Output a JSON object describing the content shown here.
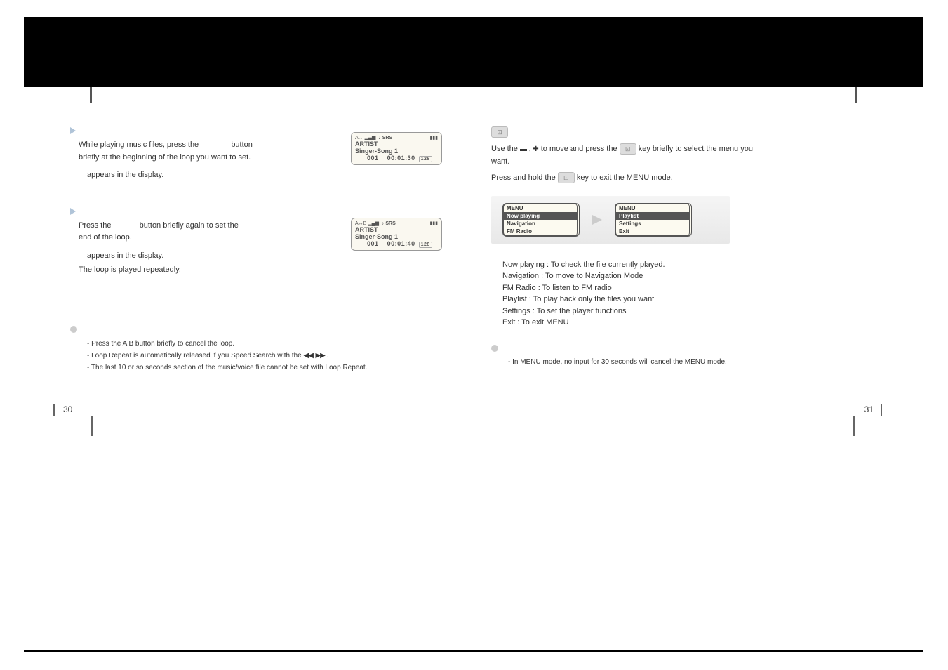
{
  "leftPage": {
    "step1": {
      "lineA": "While playing music files, press the",
      "buttonWord": "button",
      "lineB": "briefly at the beginning of the loop you want to set.",
      "result": "appears in the display."
    },
    "step2": {
      "lineA": "Press the",
      "lineB": "button briefly again to set the",
      "lineC": "end of the loop.",
      "resultA": "appears in the display.",
      "resultB": "The loop is played repeatedly."
    },
    "notes": {
      "n1": "- Press the A   B button briefly to cancel the loop.",
      "n2a": "- Loop Repeat is automatically released if you Speed Search with the  ",
      "n2icons": "◀◀, ▶▶",
      "n2b": " .",
      "n3": "- The last 10 or so seconds section of the music/voice file cannot be set with Loop Repeat."
    },
    "lcd1": {
      "topLeft": "A↔",
      "srs": "SRS",
      "artist": "ARTIST",
      "song": "Singer-Song 1",
      "track": "001",
      "time": "00:01:30",
      "badge": "128"
    },
    "lcd2": {
      "topLeft": "A↔B",
      "srs": "SRS",
      "artist": "ARTIST",
      "song": "Singer-Song 1",
      "track": "001",
      "time": "00:01:40",
      "badge": "128"
    },
    "pageNum": "30"
  },
  "rightPage": {
    "intro": {
      "a": "Use the   ",
      "moveicons": "▬ , ✚",
      "b": " to move and press the ",
      "c": " key briefly to select the menu you",
      "d": "want.",
      "e": "Press and hold the ",
      "f": " key to exit the MENU mode."
    },
    "menu1": {
      "title": "MENU",
      "items": [
        "Now playing",
        "Navigation",
        "FM Radio"
      ]
    },
    "menu2": {
      "title": "MENU",
      "items": [
        "Playlist",
        "Settings",
        "Exit"
      ]
    },
    "list": {
      "l1": "Now playing : To check the file currently played.",
      "l2": "Navigation : To move to Navigation Mode",
      "l3": "FM Radio : To listen to FM radio",
      "l4": "Playlist : To play back only the files you want",
      "l5": "Settings : To set the player functions",
      "l6": "Exit : To exit MENU"
    },
    "note": "- In MENU mode, no input for 30 seconds will cancel the MENU mode.",
    "pageNum": "31"
  }
}
